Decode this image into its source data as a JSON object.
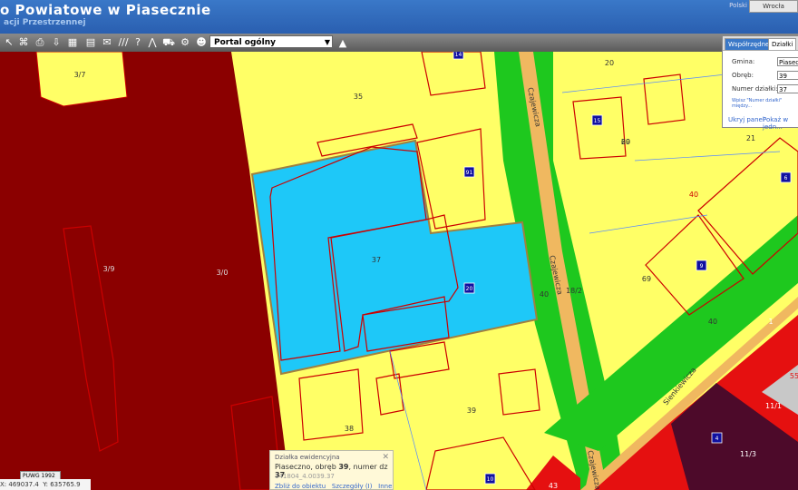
{
  "header": {
    "title": "o Powiatowe w Piasecznie",
    "subtitle": "acji Przestrzennej",
    "corner_button": "Wrocła",
    "top_links": "Polski"
  },
  "toolbar": {
    "tools": [
      {
        "name": "measure-line-icon",
        "glyph": "↖"
      },
      {
        "name": "link-icon",
        "glyph": "⌘"
      },
      {
        "name": "print-icon",
        "glyph": "⎙"
      },
      {
        "name": "download-icon",
        "glyph": "⇩"
      },
      {
        "name": "layers-icon",
        "glyph": "▦"
      },
      {
        "name": "table-icon",
        "glyph": "▤"
      },
      {
        "name": "chat-icon",
        "glyph": "✉"
      },
      {
        "name": "hatch-icon",
        "glyph": "///"
      },
      {
        "name": "help-icon",
        "glyph": "?"
      },
      {
        "name": "split-icon",
        "glyph": "⋀"
      },
      {
        "name": "cart-icon",
        "glyph": "⛟"
      },
      {
        "name": "settings-icon",
        "glyph": "⚙"
      },
      {
        "name": "users-icon",
        "glyph": "☻"
      }
    ],
    "portal_select": "Portal ogólny",
    "terrain_icon": "▲"
  },
  "side_panel": {
    "tab_a": "Współrzędne",
    "tab_b": "Działki",
    "gmina_label": "Gmina:",
    "gmina_value": "Piaseczno",
    "obreb_label": "Obręb:",
    "obreb_value": "39",
    "numer_label": "Numer działki:",
    "numer_value": "37",
    "hint": "Wpisz \"Numer działki\" między...",
    "hide_link": "Ukryj panel",
    "show_link": "Pokaż w jedn..."
  },
  "popup": {
    "title": "Działka ewidencyjna",
    "line1_prefix": "Piaseczno, obręb ",
    "line1_obreb": "39",
    "line1_mid": ", numer dz ",
    "line1_num": "37",
    "line2": "141804_4.0039.37",
    "link1": "Zbliż do obiektu",
    "link2": "Szczegóły (I)",
    "link3": "Inne"
  },
  "status": {
    "crs": "PUWG 1992",
    "x_label": "X:",
    "x_value": "469037.4",
    "y_label": "Y:",
    "y_value": "635765.9"
  },
  "map_labels": [
    {
      "t": "3/7"
    },
    {
      "t": "35"
    },
    {
      "t": "3/9"
    },
    {
      "t": "3/0"
    },
    {
      "t": "37"
    },
    {
      "t": "20"
    },
    {
      "t": "38"
    },
    {
      "t": "39"
    },
    {
      "t": "40"
    },
    {
      "t": "40"
    },
    {
      "t": "18/2"
    },
    {
      "t": "69"
    },
    {
      "t": "20"
    },
    {
      "t": "21"
    },
    {
      "t": "40"
    },
    {
      "t": "1"
    },
    {
      "t": "11/1"
    },
    {
      "t": "11/3"
    },
    {
      "t": "43"
    },
    {
      "t": "55"
    },
    {
      "t": "69"
    }
  ],
  "street_labels": [
    "Czajewicza",
    "Czajewicza",
    "Czajewicza",
    "Sienkiewicza"
  ],
  "building_numbers": [
    "14",
    "15",
    "91",
    "20",
    "9",
    "6",
    "10",
    "4"
  ],
  "colors": {
    "yellow": "#ffff66",
    "darkred": "#8b0000",
    "blue": "#1ec8f8",
    "green": "#1ec81e",
    "red": "#e51010",
    "purple": "#4d0a2a",
    "outline": "#cc0000"
  }
}
